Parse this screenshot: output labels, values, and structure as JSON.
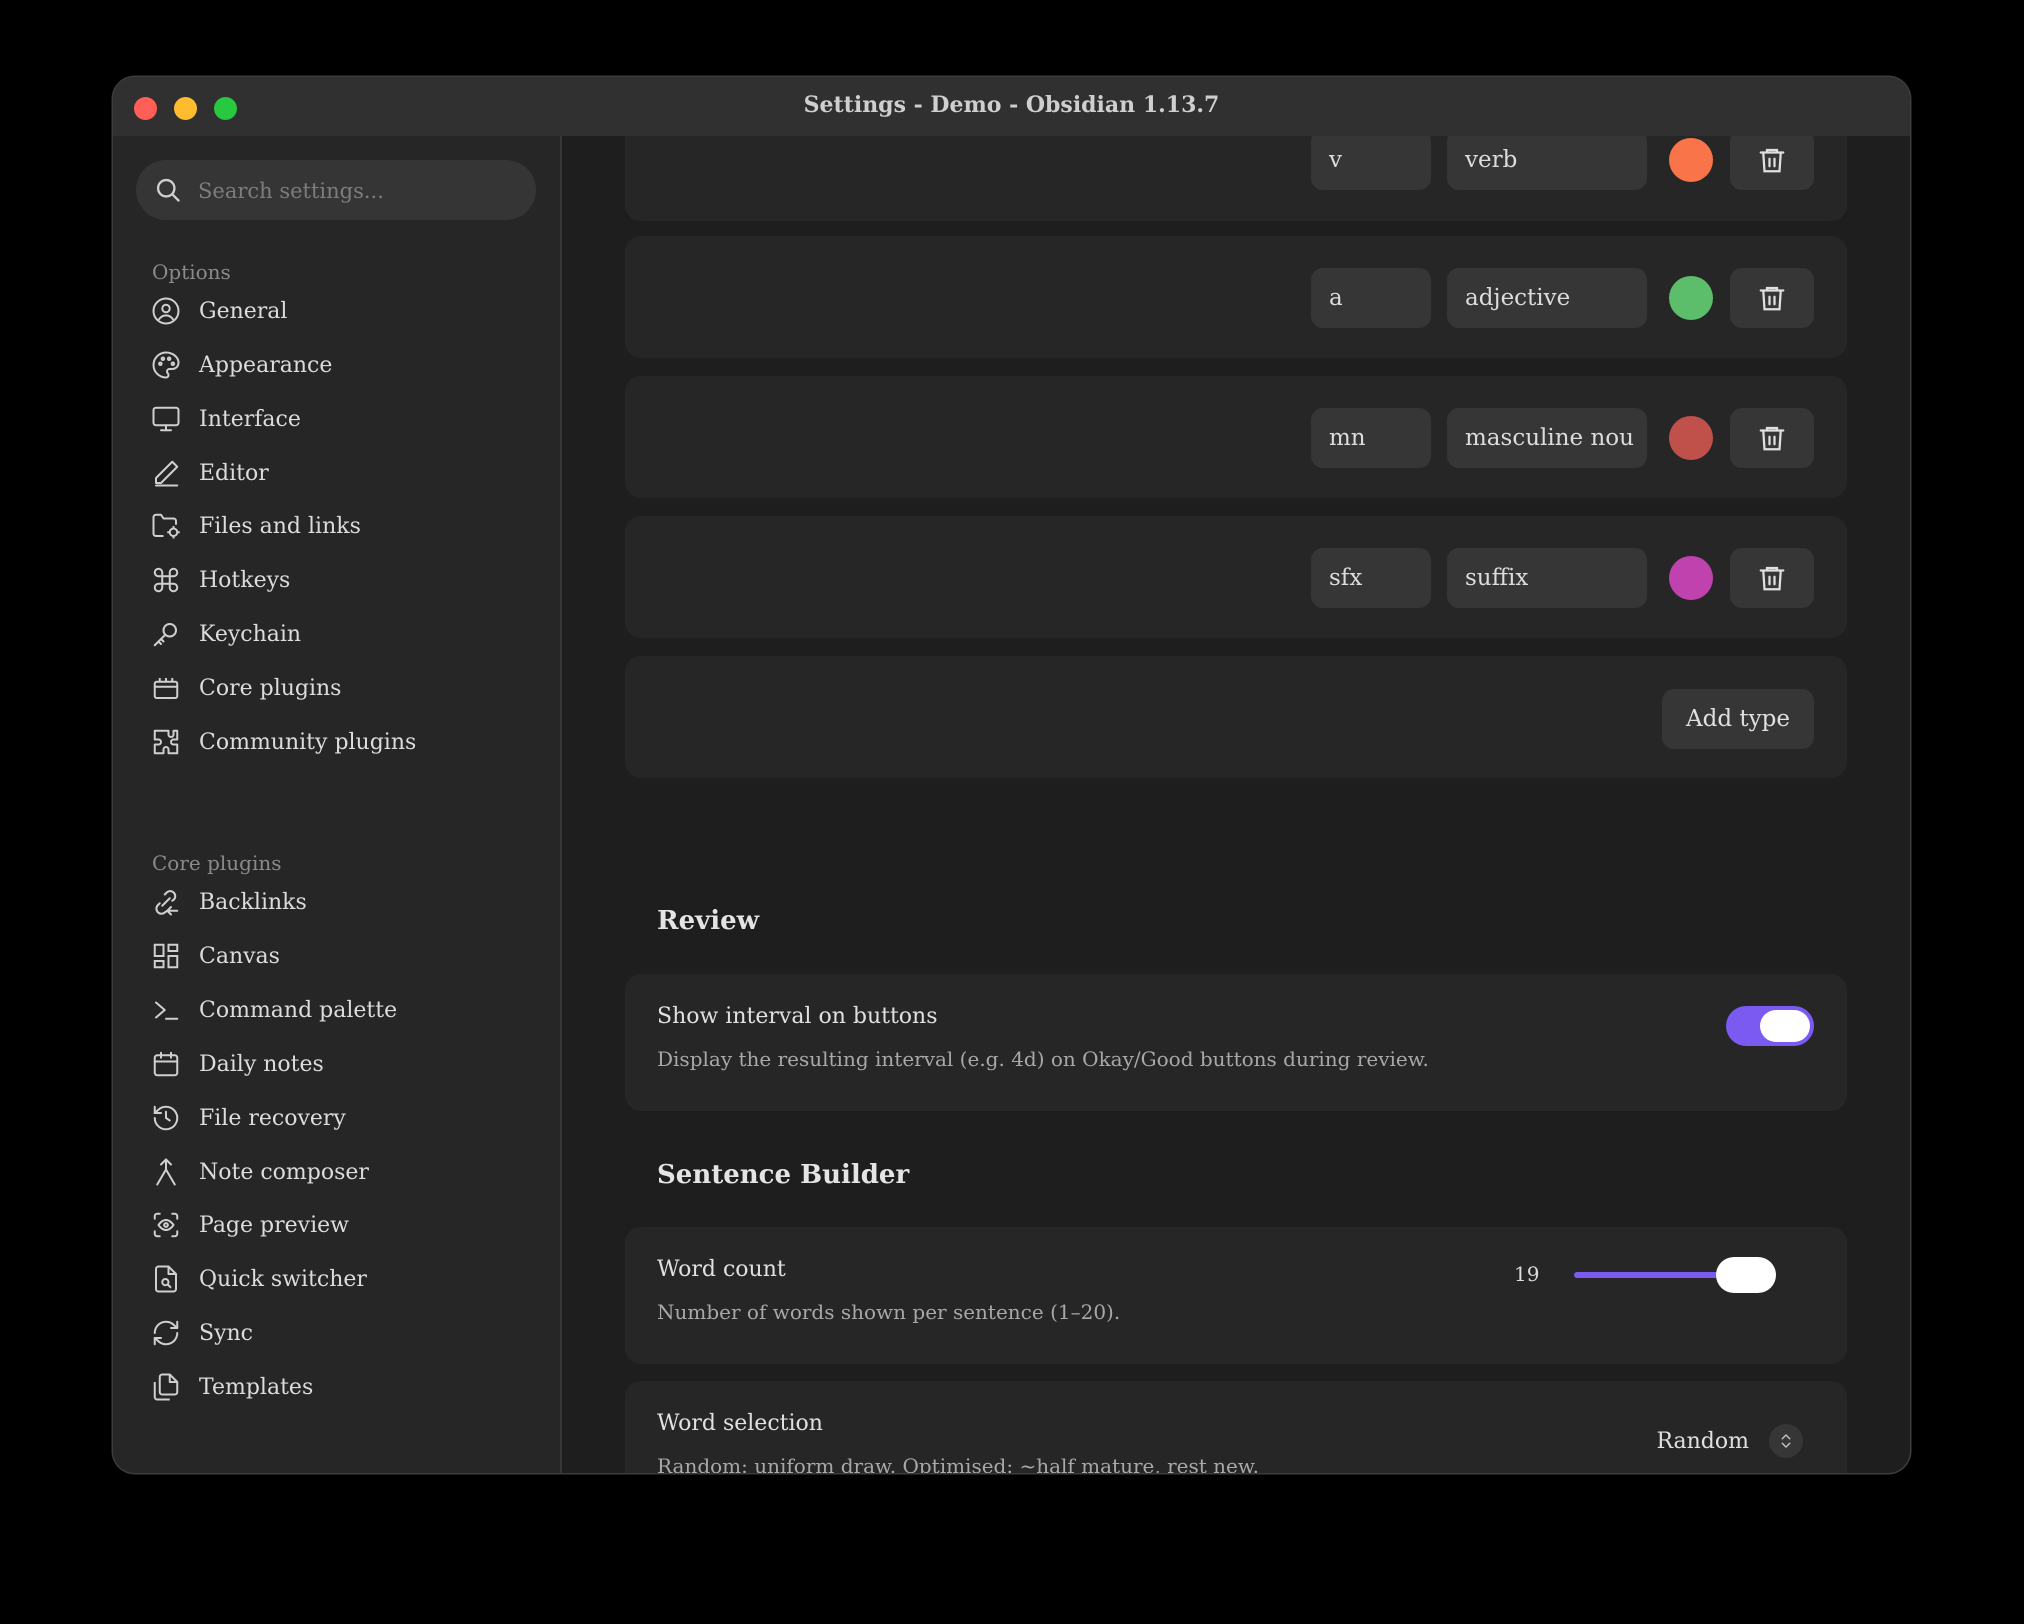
{
  "window": {
    "title": "Settings - Demo - Obsidian 1.13.7"
  },
  "search": {
    "placeholder": "Search settings..."
  },
  "sidebar": {
    "options_label": "Options",
    "options": [
      {
        "label": "General",
        "icon": "user-circle-icon"
      },
      {
        "label": "Appearance",
        "icon": "palette-icon"
      },
      {
        "label": "Interface",
        "icon": "monitor-icon"
      },
      {
        "label": "Editor",
        "icon": "pencil-icon"
      },
      {
        "label": "Files and links",
        "icon": "folder-cog-icon"
      },
      {
        "label": "Hotkeys",
        "icon": "command-icon"
      },
      {
        "label": "Keychain",
        "icon": "key-icon"
      },
      {
        "label": "Core plugins",
        "icon": "plugin-box-icon"
      },
      {
        "label": "Community plugins",
        "icon": "puzzle-icon"
      }
    ],
    "core_label": "Core plugins",
    "core": [
      {
        "label": "Backlinks",
        "icon": "backlink-icon"
      },
      {
        "label": "Canvas",
        "icon": "layout-dashboard-icon"
      },
      {
        "label": "Command palette",
        "icon": "terminal-icon"
      },
      {
        "label": "Daily notes",
        "icon": "calendar-icon"
      },
      {
        "label": "File recovery",
        "icon": "history-icon"
      },
      {
        "label": "Note composer",
        "icon": "merge-icon"
      },
      {
        "label": "Page preview",
        "icon": "scan-eye-icon"
      },
      {
        "label": "Quick switcher",
        "icon": "file-search-icon"
      },
      {
        "label": "Sync",
        "icon": "refresh-icon"
      },
      {
        "label": "Templates",
        "icon": "files-icon"
      }
    ]
  },
  "types": [
    {
      "abbr": "v",
      "name": "verb",
      "color": "#f97448"
    },
    {
      "abbr": "a",
      "name": "adjective",
      "color": "#5cbd6a"
    },
    {
      "abbr": "mn",
      "name": "masculine nou",
      "color": "#c0504a"
    },
    {
      "abbr": "sfx",
      "name": "suffix",
      "color": "#c042ae"
    }
  ],
  "add_type_label": "Add type",
  "review": {
    "heading": "Review",
    "show_interval": {
      "name": "Show interval on buttons",
      "desc": "Display the resulting interval (e.g. 4d) on Okay/Good buttons during review.",
      "enabled": true
    }
  },
  "sentence_builder": {
    "heading": "Sentence Builder",
    "word_count": {
      "name": "Word count",
      "desc": "Number of words shown per sentence (1–20).",
      "value": "19",
      "min": 1,
      "max": 20
    },
    "word_selection": {
      "name": "Word selection",
      "desc": "Random: uniform draw. Optimised: ~half mature, rest new.",
      "value": "Random"
    }
  },
  "colors": {
    "accent": "#7a5af0"
  }
}
